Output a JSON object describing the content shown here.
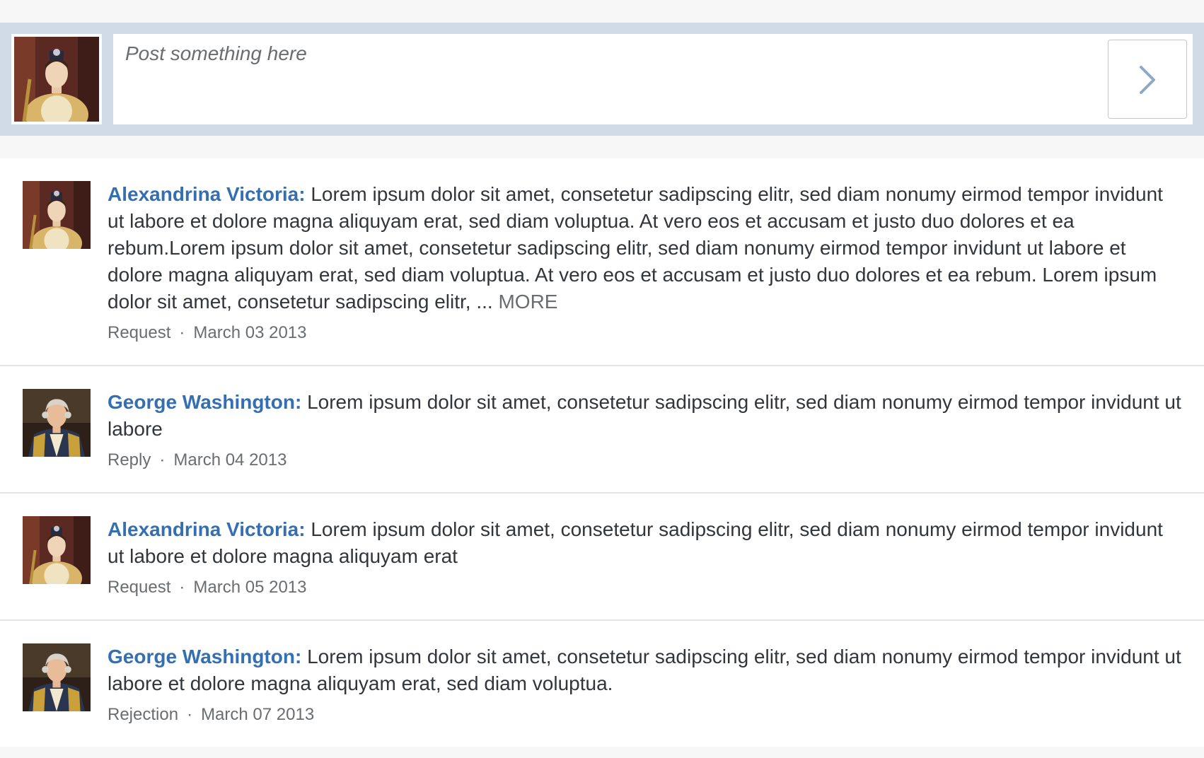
{
  "composer": {
    "placeholder": "Post something here"
  },
  "feed": [
    {
      "avatar": "victoria",
      "author": "Alexandrina Victoria:",
      "text": "Lorem ipsum dolor sit amet, consetetur sadipscing elitr, sed diam nonumy eirmod tempor invidunt ut labore et dolore magna aliquyam erat, sed diam voluptua. At vero eos et accusam et justo duo dolores et ea rebum.Lorem ipsum dolor sit amet, consetetur sadipscing elitr, sed diam nonumy eirmod tempor invidunt ut labore et dolore magna aliquyam erat, sed diam voluptua. At vero eos et accusam et justo duo dolores et ea rebum. Lorem ipsum dolor sit amet, consetetur sadipscing elitr, ...",
      "more": "MORE",
      "type": "Request",
      "separator": "·",
      "date": "March 03 2013"
    },
    {
      "avatar": "washington",
      "author": "George Washington:",
      "text": "Lorem ipsum dolor sit amet, consetetur sadipscing elitr, sed diam nonumy eirmod tempor invidunt ut labore",
      "type": "Reply",
      "separator": "·",
      "date": "March 04 2013"
    },
    {
      "avatar": "victoria",
      "author": "Alexandrina Victoria:",
      "text": "Lorem ipsum dolor sit amet, consetetur sadipscing elitr, sed diam nonumy eirmod tempor invidunt ut labore et dolore magna aliquyam erat",
      "type": "Request",
      "separator": "·",
      "date": "March 05 2013"
    },
    {
      "avatar": "washington",
      "author": "George Washington:",
      "text": "Lorem ipsum dolor sit amet, consetetur sadipscing elitr, sed diam nonumy eirmod tempor invidunt ut labore et dolore magna aliquyam erat, sed diam voluptua.",
      "type": "Rejection",
      "separator": "·",
      "date": "March 07 2013"
    }
  ],
  "colors": {
    "author_link": "#346fb1",
    "composer_bg": "#d1dbe8",
    "meta_text": "#6a6d70"
  },
  "icons": {
    "post_button": "chevron-right-icon"
  }
}
